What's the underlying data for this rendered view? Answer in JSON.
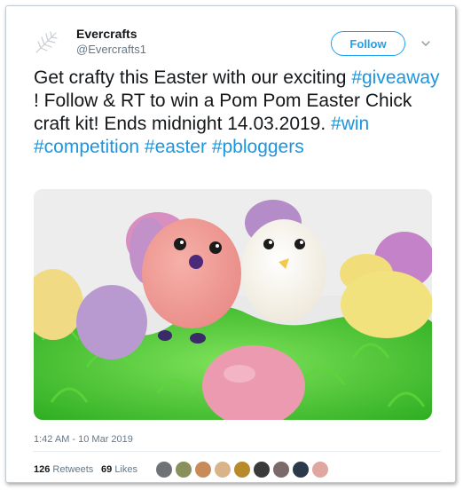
{
  "author": {
    "name": "Evercrafts",
    "handle": "@Evercrafts1",
    "avatar_icon": "leaf-logo-icon"
  },
  "follow_label": "Follow",
  "tweet": {
    "segments": [
      {
        "text": "Get crafty this Easter with our exciting ",
        "hashtag": false
      },
      {
        "text": "#giveaway",
        "hashtag": true
      },
      {
        "text": " ! Follow & RT to win a Pom Pom Easter Chick craft kit! Ends midnight 14.03.2019. ",
        "hashtag": false
      },
      {
        "text": "#win",
        "hashtag": true
      },
      {
        "text": " ",
        "hashtag": false
      },
      {
        "text": "#competition",
        "hashtag": true
      },
      {
        "text": " ",
        "hashtag": false
      },
      {
        "text": "#easter",
        "hashtag": true
      },
      {
        "text": " ",
        "hashtag": false
      },
      {
        "text": "#pbloggers",
        "hashtag": true
      }
    ]
  },
  "timestamp": "1:42 AM - 10 Mar 2019",
  "stats": {
    "retweets_count": "126",
    "retweets_label": "Retweets",
    "likes_count": "69",
    "likes_label": "Likes"
  },
  "likers": [
    "#6f7378",
    "#8a8f5e",
    "#c98a5a",
    "#d9b48a",
    "#b88a2a",
    "#3a3a3a",
    "#7a6a6a",
    "#2a3a4a",
    "#e0a6a0"
  ],
  "colors": {
    "accent": "#1da1f2",
    "hashtag": "#1b95e0",
    "secondary_text": "#657786"
  }
}
